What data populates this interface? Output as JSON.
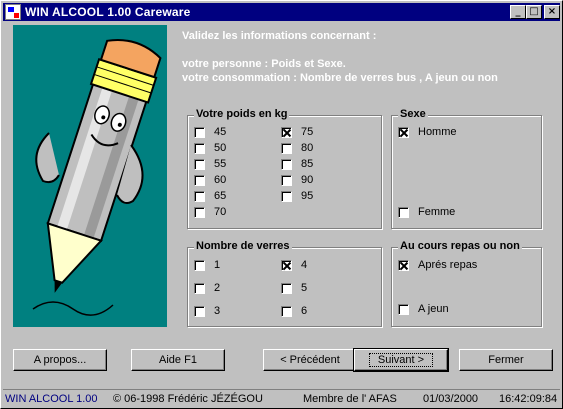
{
  "window": {
    "title": "WIN ALCOOL 1.00 Careware",
    "minimize_glyph": "_",
    "maximize_glyph": "□",
    "close_glyph": "×"
  },
  "intro": {
    "line1": "Validez les informations concernant :",
    "line2": "votre personne : Poids et Sexe.",
    "line3": "votre consommation : Nombre de verres bus , A jeun ou non"
  },
  "weight": {
    "legend": "Votre poids en kg",
    "options": [
      {
        "label": "45",
        "checked": false
      },
      {
        "label": "50",
        "checked": false
      },
      {
        "label": "55",
        "checked": false
      },
      {
        "label": "60",
        "checked": false
      },
      {
        "label": "65",
        "checked": false
      },
      {
        "label": "70",
        "checked": false
      },
      {
        "label": "75",
        "checked": true
      },
      {
        "label": "80",
        "checked": false
      },
      {
        "label": "85",
        "checked": false
      },
      {
        "label": "90",
        "checked": false
      },
      {
        "label": "95",
        "checked": false
      }
    ]
  },
  "sex": {
    "legend": "Sexe",
    "options": [
      {
        "label": "Homme",
        "checked": true
      },
      {
        "label": "Femme",
        "checked": false
      }
    ]
  },
  "glasses": {
    "legend": "Nombre de verres",
    "options": [
      {
        "label": "1",
        "checked": false
      },
      {
        "label": "2",
        "checked": false
      },
      {
        "label": "3",
        "checked": false
      },
      {
        "label": "4",
        "checked": true
      },
      {
        "label": "5",
        "checked": false
      },
      {
        "label": "6",
        "checked": false
      }
    ]
  },
  "meal": {
    "legend": "Au cours repas ou non",
    "options": [
      {
        "label": "Aprés repas",
        "checked": true
      },
      {
        "label": "A jeun",
        "checked": false
      }
    ]
  },
  "buttons": {
    "about": "A propos...",
    "help": "Aide F1",
    "previous": "< Précédent",
    "next": "Suivant >",
    "close": "Fermer"
  },
  "status": {
    "app": "WIN ALCOOL 1.00",
    "copyright": "© 06-1998 Frédéric JÉZÉGOU",
    "member": "Membre de l' AFAS",
    "date": "01/03/2000",
    "time": "16:42:09:84"
  },
  "colors": {
    "titlebar": "#000080",
    "illustration_bg": "#008080",
    "window_bg": "#c0c0c0"
  }
}
